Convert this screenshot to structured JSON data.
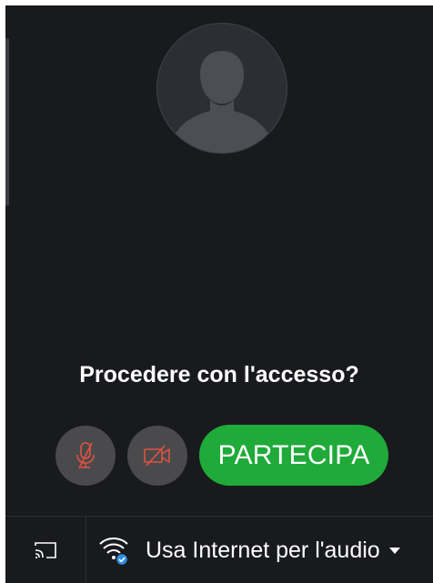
{
  "preview": {
    "avatar_icon": "user-silhouette-icon"
  },
  "prompt": {
    "text": "Procedere con l'accesso?"
  },
  "controls": {
    "mic": {
      "icon": "mic-off-icon",
      "state": "off"
    },
    "camera": {
      "icon": "video-off-icon",
      "state": "off"
    },
    "join_label": "PARTECIPA"
  },
  "bottom_bar": {
    "cast_icon": "cast-icon",
    "audio_icon": "wifi-audio-icon",
    "audio_label": "Usa Internet per l'audio",
    "dropdown_icon": "caret-down-icon"
  },
  "colors": {
    "background": "#181a1d",
    "join_green": "#1faa39",
    "off_red": "#e0523e",
    "badge_blue": "#2f8de4"
  }
}
